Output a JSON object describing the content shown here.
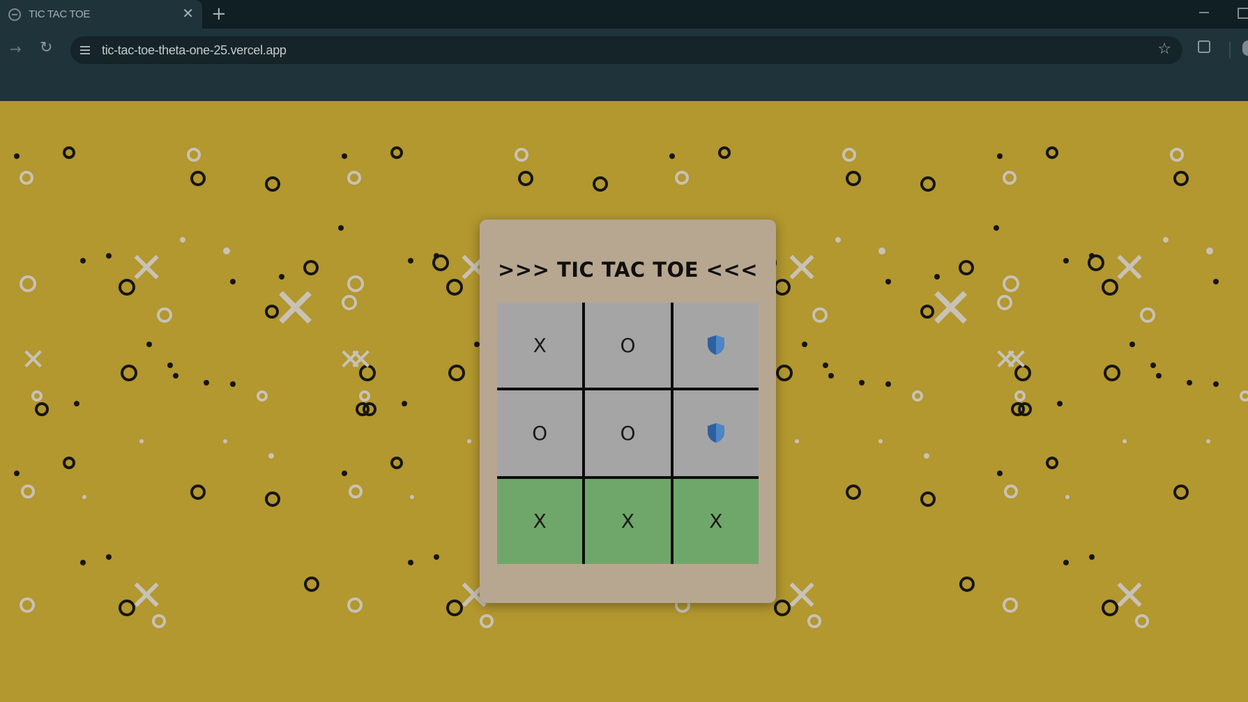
{
  "browser": {
    "tab_title": "TIC TAC TOE",
    "tab_close": "✕",
    "new_tab": "+",
    "url": "tic-tac-toe-theta-one-25.vercel.app",
    "forward_glyph": "→",
    "reload_glyph": "↻",
    "star_glyph": "☆"
  },
  "game": {
    "title": ">>> TIC TAC TOE <<<",
    "cells": [
      {
        "value": "X",
        "state": "normal"
      },
      {
        "value": "O",
        "state": "normal"
      },
      {
        "value": "",
        "state": "normal",
        "icon": "shield-icon"
      },
      {
        "value": "O",
        "state": "normal"
      },
      {
        "value": "O",
        "state": "normal"
      },
      {
        "value": "",
        "state": "normal",
        "icon": "shield-icon"
      },
      {
        "value": "X",
        "state": "win"
      },
      {
        "value": "X",
        "state": "win"
      },
      {
        "value": "X",
        "state": "win"
      }
    ]
  },
  "colors": {
    "page_background": "#b3972f",
    "card": "#b7a790",
    "cell": "#a5a5a5",
    "win_cell": "#6fa76a"
  }
}
